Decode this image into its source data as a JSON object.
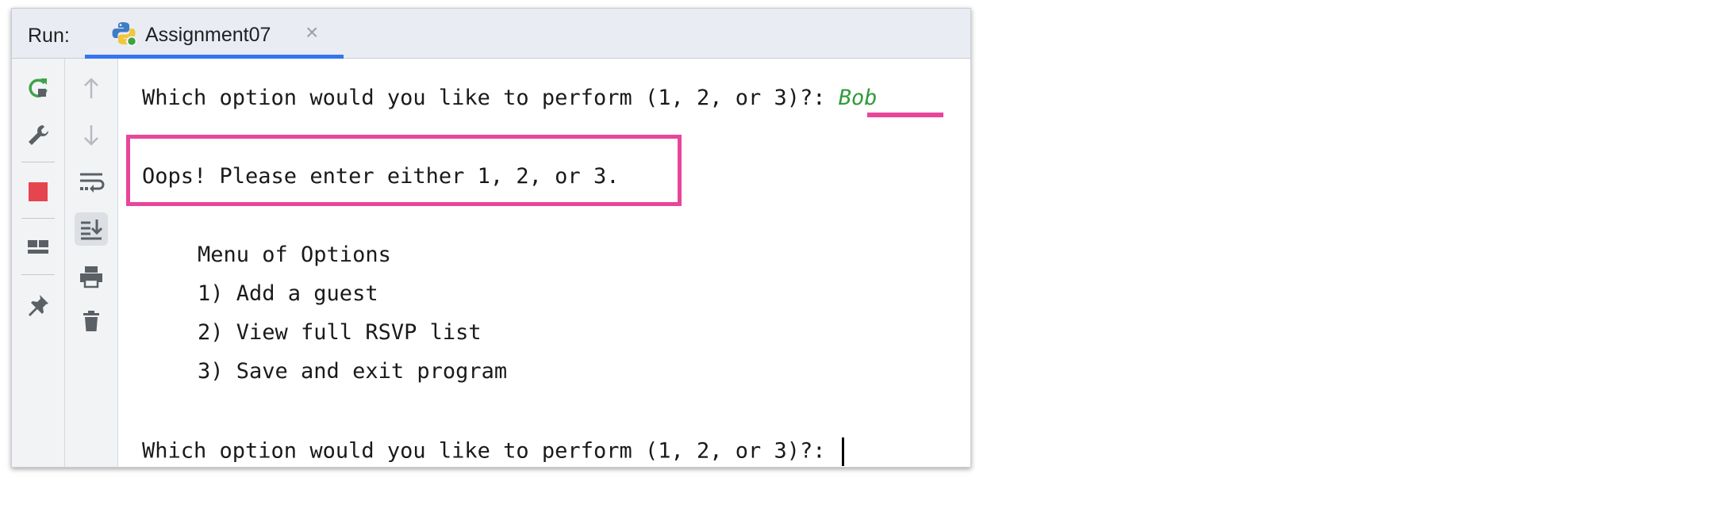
{
  "run_panel": {
    "label": "Run:",
    "tab": {
      "title": "Assignment07",
      "icon": "python-icon",
      "close_icon": "close-icon"
    }
  },
  "toolbar_left": [
    {
      "icon": "rerun-icon"
    },
    {
      "icon": "wrench-icon"
    },
    {
      "icon": "stop-icon"
    },
    {
      "icon": "layout-icon"
    },
    {
      "icon": "pin-icon"
    }
  ],
  "toolbar_right": [
    {
      "icon": "arrow-up-icon"
    },
    {
      "icon": "arrow-down-icon"
    },
    {
      "icon": "soft-wrap-icon"
    },
    {
      "icon": "scroll-to-end-icon"
    },
    {
      "icon": "print-icon"
    },
    {
      "icon": "trash-icon"
    }
  ],
  "console": {
    "prompt1": "Which option would you like to perform (1, 2, or 3)?: ",
    "input1": "Bob",
    "error": "Oops! Please enter either 1, 2, or 3.",
    "menu_title": "Menu of Options",
    "menu_items": [
      "1) Add a guest",
      "2) View full RSVP list",
      "3) Save and exit program"
    ],
    "prompt2": "Which option would you like to perform (1, 2, or 3)?: "
  },
  "colors": {
    "annotation": "#e8469b",
    "input_text": "#2f9b3a",
    "tab_accent": "#3574f0",
    "stop": "#e5454f",
    "rerun": "#3fa24b"
  }
}
